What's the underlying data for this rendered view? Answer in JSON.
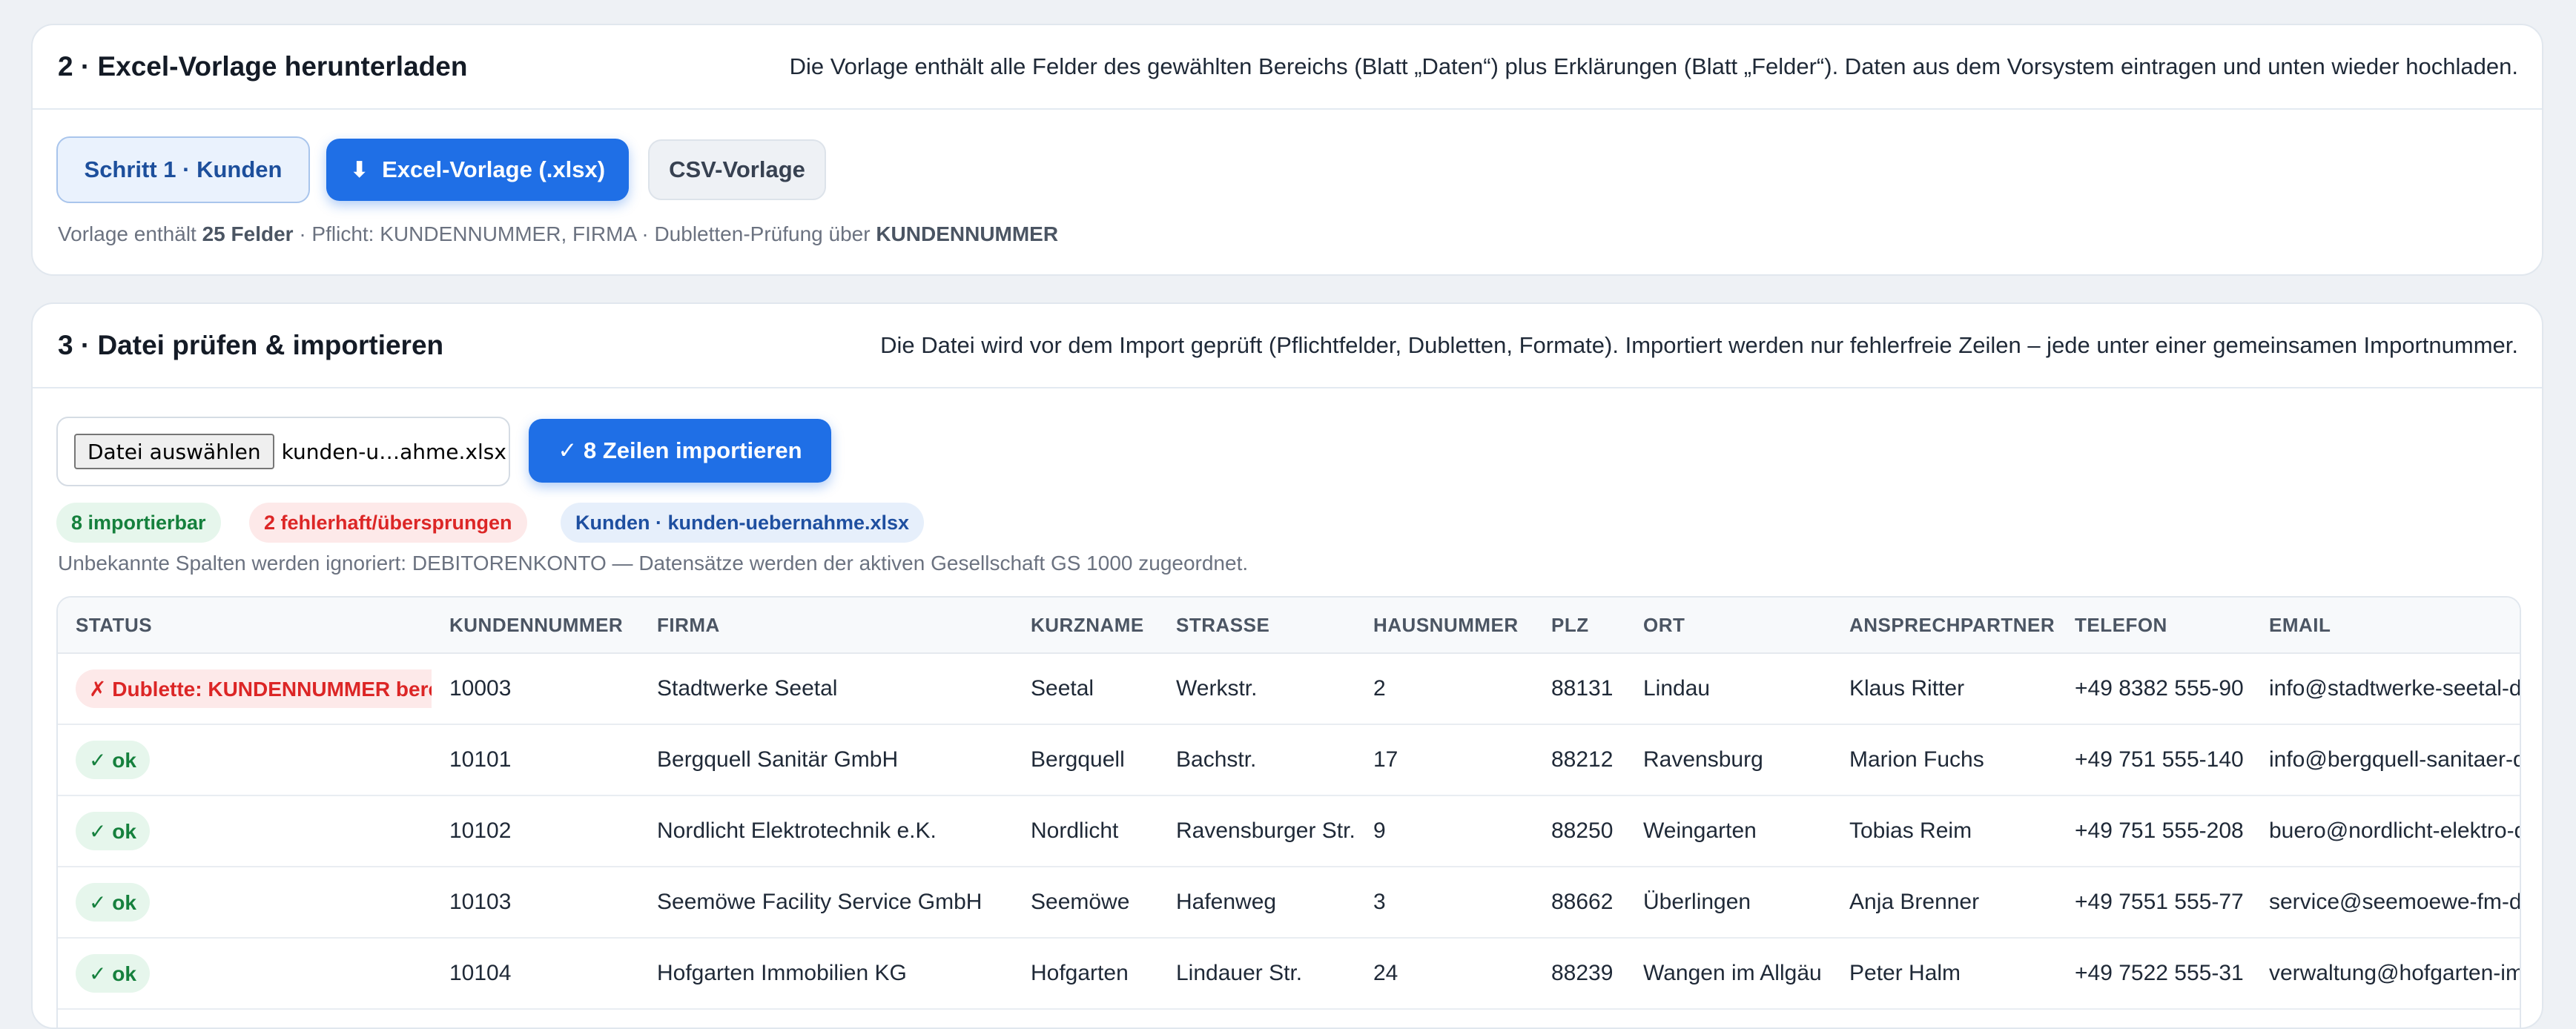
{
  "step2": {
    "title": "2 · Excel-Vorlage herunterladen",
    "description": "Die Vorlage enthält alle Felder des gewählten Bereichs (Blatt „Daten“) plus Erklärungen (Blatt „Felder“). Daten aus dem Vorsystem eintragen und unten wieder hochladen.",
    "step_button": "Schritt 1 · Kunden",
    "xlsx_icon": "⬇",
    "xlsx_button": "Excel-Vorlage (.xlsx)",
    "csv_button": "CSV-Vorlage",
    "meta_prefix": "Vorlage enthält ",
    "meta_fields": "25 Felder",
    "meta_middle": " · Pflicht: KUNDENNUMMER, FIRMA · Dubletten-Prüfung über ",
    "meta_key": "KUNDENNUMMER"
  },
  "step3": {
    "title": "3 · Datei prüfen & importieren",
    "description": "Die Datei wird vor dem Import geprüft (Pflichtfelder, Dubletten, Formate). Importiert werden nur fehlerfreie Zeilen – jede unter einer gemeinsamen Importnummer.",
    "file_button": "Datei auswählen",
    "file_name": "kunden-u…ahme.xlsx",
    "import_button": "✓ 8 Zeilen importieren",
    "pill_ok": "8 importierbar",
    "pill_err": "2 fehlerhaft/übersprungen",
    "pill_source": "Kunden · kunden-uebernahme.xlsx",
    "note": "Unbekannte Spalten werden ignoriert: DEBITORENKONTO — Datensätze werden der aktiven Gesellschaft GS 1000 zugeordnet."
  },
  "table": {
    "headers": [
      "STATUS",
      "KUNDENNUMMER",
      "FIRMA",
      "KURZNAME",
      "STRASSE",
      "HAUSNUMMER",
      "PLZ",
      "ORT",
      "ANSPRECHPARTNER",
      "TELEFON",
      "EMAIL"
    ],
    "rows": [
      {
        "status": "✗ Dublette: KUNDENNUMMER bereits vorhanden",
        "status_type": "err",
        "cells": [
          "10003",
          "Stadtwerke Seetal",
          "Seetal",
          "Werkstr.",
          "2",
          "88131",
          "Lindau",
          "Klaus Ritter",
          "+49 8382 555-90",
          "info@stadtwerke-seetal-de"
        ]
      },
      {
        "status": "✓ ok",
        "status_type": "ok",
        "cells": [
          "10101",
          "Bergquell Sanitär GmbH",
          "Bergquell",
          "Bachstr.",
          "17",
          "88212",
          "Ravensburg",
          "Marion Fuchs",
          "+49 751 555-140",
          "info@bergquell-sanitaer-de"
        ]
      },
      {
        "status": "✓ ok",
        "status_type": "ok",
        "cells": [
          "10102",
          "Nordlicht Elektrotechnik e.K.",
          "Nordlicht",
          "Ravensburger Str.",
          "9",
          "88250",
          "Weingarten",
          "Tobias Reim",
          "+49 751 555-208",
          "buero@nordlicht-elektro-de"
        ]
      },
      {
        "status": "✓ ok",
        "status_type": "ok",
        "cells": [
          "10103",
          "Seemöwe Facility Service GmbH",
          "Seemöwe",
          "Hafenweg",
          "3",
          "88662",
          "Überlingen",
          "Anja Brenner",
          "+49 7551 555-77",
          "service@seemoewe-fm-de"
        ]
      },
      {
        "status": "✓ ok",
        "status_type": "ok",
        "cells": [
          "10104",
          "Hofgarten Immobilien KG",
          "Hofgarten",
          "Lindauer Str.",
          "24",
          "88239",
          "Wangen im Allgäu",
          "Peter Halm",
          "+49 7522 555-31",
          "verwaltung@hofgarten-immo-de"
        ]
      }
    ]
  }
}
